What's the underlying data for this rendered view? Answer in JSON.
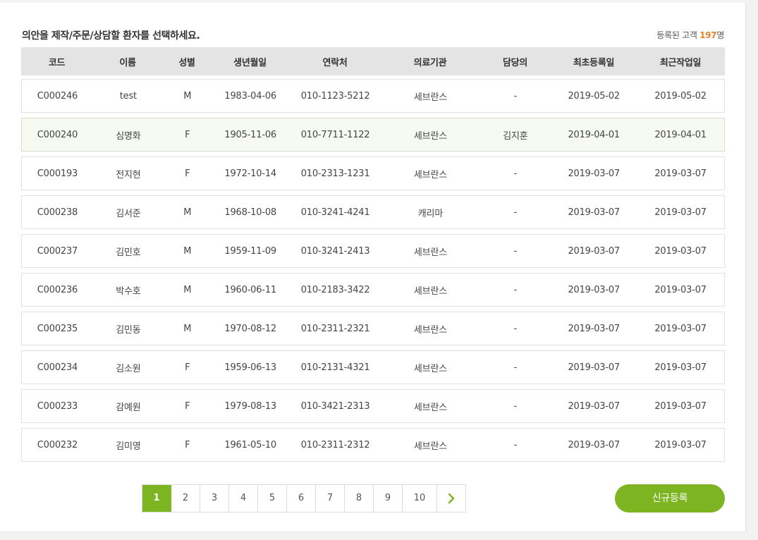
{
  "instruction": "의안을 제작/주문/상담할 환자를 선택하세요.",
  "count": {
    "prefix": "등록된 고객",
    "number": "197",
    "suffix": "명"
  },
  "columns": [
    "코드",
    "이름",
    "성별",
    "생년월일",
    "연락처",
    "의료기관",
    "담당의",
    "최초등록일",
    "최근작업일"
  ],
  "rows": [
    [
      "C000246",
      "test",
      "M",
      "1983-04-06",
      "010-1123-5212",
      "세브란스",
      "-",
      "2019-05-02",
      "2019-05-02"
    ],
    [
      "C000240",
      "심명화",
      "F",
      "1905-11-06",
      "010-7711-1122",
      "세브란스",
      "김지훈",
      "2019-04-01",
      "2019-04-01"
    ],
    [
      "C000193",
      "전지현",
      "F",
      "1972-10-14",
      "010-2313-1231",
      "세브란스",
      "-",
      "2019-03-07",
      "2019-03-07"
    ],
    [
      "C000238",
      "김서준",
      "M",
      "1968-10-08",
      "010-3241-4241",
      "캐리마",
      "-",
      "2019-03-07",
      "2019-03-07"
    ],
    [
      "C000237",
      "김민호",
      "M",
      "1959-11-09",
      "010-3241-2413",
      "세브란스",
      "-",
      "2019-03-07",
      "2019-03-07"
    ],
    [
      "C000236",
      "박수호",
      "M",
      "1960-06-11",
      "010-2183-3422",
      "세브란스",
      "-",
      "2019-03-07",
      "2019-03-07"
    ],
    [
      "C000235",
      "김민동",
      "M",
      "1970-08-12",
      "010-2311-2321",
      "세브란스",
      "-",
      "2019-03-07",
      "2019-03-07"
    ],
    [
      "C000234",
      "김소원",
      "F",
      "1959-06-13",
      "010-2131-4321",
      "세브란스",
      "-",
      "2019-03-07",
      "2019-03-07"
    ],
    [
      "C000233",
      "감예원",
      "F",
      "1979-08-13",
      "010-3421-2313",
      "세브란스",
      "-",
      "2019-03-07",
      "2019-03-07"
    ],
    [
      "C000232",
      "김미영",
      "F",
      "1961-05-10",
      "010-2311-2312",
      "세브란스",
      "-",
      "2019-03-07",
      "2019-03-07"
    ]
  ],
  "selected_row": 1,
  "pagination": {
    "pages": [
      "1",
      "2",
      "3",
      "4",
      "5",
      "6",
      "7",
      "8",
      "9",
      "10"
    ],
    "active": "1",
    "next_icon": "chevron-right-icon"
  },
  "new_button_label": "신규등록",
  "colors": {
    "accent": "#7cb521",
    "count_highlight": "#e8822a",
    "header_bg": "#e4e4e4"
  }
}
